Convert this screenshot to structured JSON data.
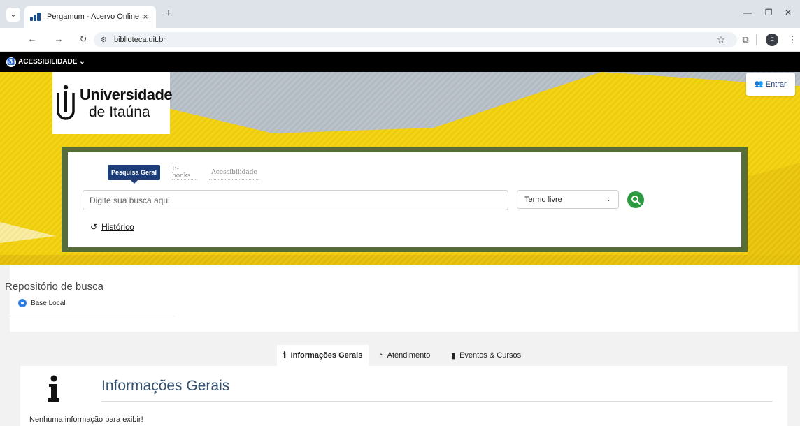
{
  "browser": {
    "tab_title": "Pergamum - Acervo Online",
    "tab_close": "×",
    "new_tab": "+",
    "url": "biblioteca.uit.br",
    "profile_initial": "F",
    "icons": [
      "chevron-down-icon",
      "back-arrow-icon",
      "forward-arrow-icon",
      "reload-icon",
      "site-info-icon",
      "star-icon",
      "extensions-icon",
      "kebab-menu-icon",
      "minimize-icon",
      "maximize-icon",
      "close-icon"
    ]
  },
  "accessibility_bar": {
    "label": "ACESSIBILIDADE"
  },
  "header": {
    "logo_line1": "Universidade",
    "logo_line2": "de Itaúna",
    "login_label": "Entrar"
  },
  "search": {
    "tabs": [
      {
        "label": "Pesquisa Geral",
        "active": true
      },
      {
        "label": "E-books",
        "active": false
      },
      {
        "label": "Acessibilidade",
        "active": false
      }
    ],
    "placeholder": "Digite sua busca aqui",
    "filter_selected": "Termo livre",
    "history_label": "Histórico"
  },
  "repository": {
    "title": "Repositório de busca",
    "option": "Base Local"
  },
  "info": {
    "tabs": [
      {
        "label": "Informações Gerais",
        "active": true
      },
      {
        "label": "Atendimento",
        "active": false
      },
      {
        "label": "Eventos & Cursos",
        "active": false
      }
    ],
    "heading": "Informações Gerais",
    "empty_message": "Nenhuma informação para exibir!"
  },
  "colors": {
    "banner_yellow": "#f4d20c",
    "search_frame": "#566d3a",
    "primary_blue": "#1d3d78",
    "search_green": "#2d9a41",
    "radio_blue": "#2f7de1"
  }
}
